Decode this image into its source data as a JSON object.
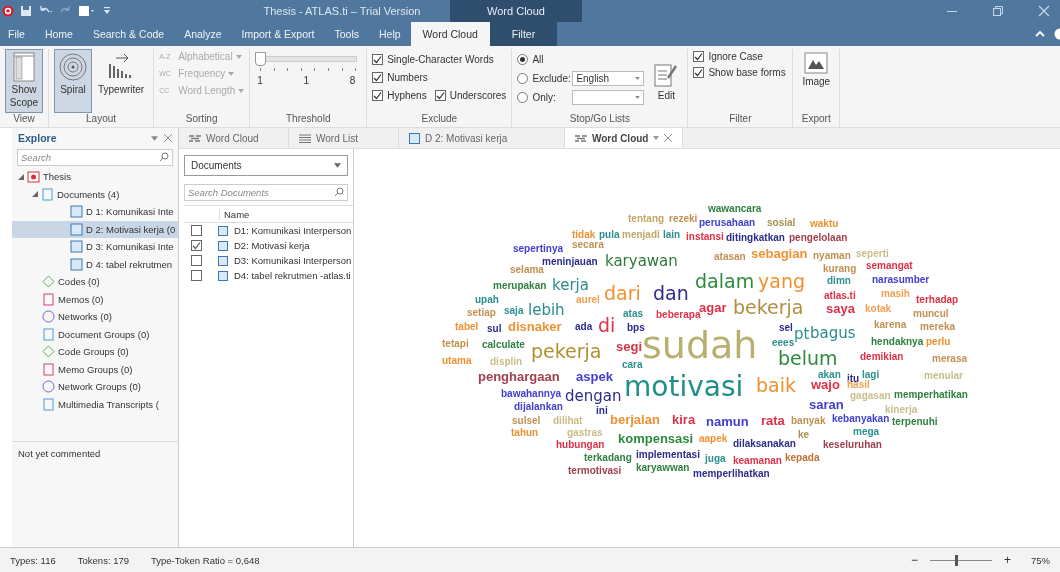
{
  "window": {
    "title": "Thesis - ATLAS.ti – Trial Version",
    "context_title": "Word Cloud"
  },
  "menu_tabs": [
    {
      "label": "File",
      "selected": false
    },
    {
      "label": "Home",
      "selected": false
    },
    {
      "label": "Search & Code",
      "selected": false
    },
    {
      "label": "Analyze",
      "selected": false
    },
    {
      "label": "Import & Export",
      "selected": false
    },
    {
      "label": "Tools",
      "selected": false
    },
    {
      "label": "Help",
      "selected": false
    },
    {
      "label": "Word Cloud",
      "selected": true
    },
    {
      "label": "Filter",
      "selected": false
    }
  ],
  "ribbon": {
    "view": {
      "label": "View",
      "button": {
        "label": "Show Scope",
        "selected": true
      }
    },
    "layout": {
      "label": "Layout",
      "buttons": [
        {
          "label": "Spiral",
          "kind": "spiral",
          "selected": true
        },
        {
          "label": "Typewriter",
          "kind": "typewriter",
          "selected": false
        }
      ]
    },
    "sorting": {
      "label": "Sorting",
      "options": [
        {
          "icon_text": "A-Z",
          "label": "Alphabetical",
          "disabled": true
        },
        {
          "icon_text": "WC",
          "label": "Frequency",
          "disabled": true
        },
        {
          "icon_text": "CC",
          "label": "Word Length",
          "disabled": true
        }
      ]
    },
    "threshold": {
      "label": "Threshold",
      "level": 0,
      "ticks": [
        "1",
        "1",
        "8"
      ]
    },
    "exclude": {
      "label": "Exclude",
      "checkboxes": [
        {
          "label": "Single-Character Words",
          "checked": true
        },
        {
          "label": "Numbers",
          "checked": true
        },
        {
          "label": "Hyphens",
          "checked": true
        },
        {
          "label": "Underscores",
          "checked": true
        }
      ]
    },
    "stop_go": {
      "label": "Stop/Go Lists",
      "radios": [
        {
          "label": "All",
          "selected": true
        },
        {
          "label": "Exclude:",
          "selected": false,
          "value": "English"
        },
        {
          "label": "Only:",
          "selected": false
        }
      ],
      "edit": "Edit"
    },
    "filter": {
      "label": "Filter",
      "checkboxes": [
        {
          "label": "Ignore Case",
          "checked": true
        },
        {
          "label": "Show base forms",
          "checked": true
        }
      ]
    },
    "export": {
      "label": "Export",
      "button": "Image"
    }
  },
  "explore": {
    "title": "Explore",
    "search_placeholder": "Search",
    "tree": [
      {
        "label": "Thesis",
        "kind": "project",
        "expanded": true,
        "selected": false,
        "children": [
          {
            "label": "Documents (4)",
            "kind": "documents",
            "expanded": true,
            "selected": false,
            "children": [
              {
                "label": "D 1: Komunikasi Inte",
                "kind": "doc",
                "selected": false
              },
              {
                "label": "D 2: Motivasi kerja (0",
                "kind": "doc",
                "selected": true
              },
              {
                "label": "D 3: Komunikasi Inte",
                "kind": "doc",
                "selected": false
              },
              {
                "label": "D 4: tabel rekrutmen",
                "kind": "doc",
                "selected": false
              }
            ]
          },
          {
            "label": "Codes (0)",
            "kind": "codes",
            "selected": false
          },
          {
            "label": "Memos (0)",
            "kind": "memos",
            "selected": false
          },
          {
            "label": "Networks (0)",
            "kind": "networks",
            "selected": false
          },
          {
            "label": "Document Groups (0)",
            "kind": "docgroups",
            "selected": false
          },
          {
            "label": "Code Groups (0)",
            "kind": "codegroups",
            "selected": false
          },
          {
            "label": "Memo Groups (0)",
            "kind": "memogroups",
            "selected": false
          },
          {
            "label": "Network Groups (0)",
            "kind": "netgroups",
            "selected": false
          },
          {
            "label": "Multimedia Transcripts (",
            "kind": "transcripts",
            "selected": false
          }
        ]
      }
    ],
    "comment": "Not yet commented"
  },
  "doc_tabs": [
    {
      "label": "Word Cloud",
      "kind": "cloud",
      "selected": false
    },
    {
      "label": "Word List",
      "kind": "list",
      "selected": false
    },
    {
      "label": "D 2: Motivasi kerja",
      "kind": "document",
      "selected": false
    },
    {
      "label": "Word Cloud",
      "kind": "cloud",
      "selected": true
    }
  ],
  "documents": {
    "dropdown": "Documents",
    "search_placeholder": "Search Documents",
    "column": "Name",
    "rows": [
      {
        "name": "D1: Komunikasi Interperson",
        "checked": false
      },
      {
        "name": "D2: Motivasi kerja",
        "checked": true
      },
      {
        "name": "D3: Komunikasi Interperson",
        "checked": false
      },
      {
        "name": "D4: tabel rekrutmen -atlas.ti",
        "checked": false
      }
    ]
  },
  "cloud": {
    "words": [
      {
        "text": "wawancara",
        "kind": "tiny",
        "color": "#2e8040"
      },
      {
        "text": "tentang",
        "kind": "tiny",
        "color": "#c0a868"
      },
      {
        "text": "rezeki",
        "kind": "tiny",
        "color": "#c09050"
      },
      {
        "text": "perusahaan",
        "kind": "tiny",
        "color": "#4040d0"
      },
      {
        "text": "sosial",
        "kind": "tiny",
        "color": "#a89050"
      },
      {
        "text": "waktu",
        "kind": "tiny",
        "color": "#f09030"
      },
      {
        "text": "tidak",
        "kind": "tiny",
        "color": "#f09030"
      },
      {
        "text": "pula",
        "kind": "tiny",
        "color": "#2a9090"
      },
      {
        "text": "menjadi",
        "kind": "tiny",
        "color": "#c0a868"
      },
      {
        "text": "lain",
        "kind": "tiny",
        "color": "#2a9090"
      },
      {
        "text": "instansi",
        "kind": "tiny",
        "color": "#e03048"
      },
      {
        "text": "ditingkatkan",
        "kind": "tiny",
        "color": "#2c2c8c"
      },
      {
        "text": "pengelolaan",
        "kind": "tiny",
        "color": "#a0404a"
      },
      {
        "text": "sepertinya",
        "kind": "tiny",
        "color": "#4040d0"
      },
      {
        "text": "secara",
        "kind": "tiny",
        "color": "#c09050"
      },
      {
        "text": "meninjauan",
        "kind": "tiny",
        "color": "#2c2c8c"
      },
      {
        "text": "karyawan",
        "kind": "medium",
        "color": "#2e7a3e"
      },
      {
        "text": "atasan",
        "kind": "tiny",
        "color": "#c09050"
      },
      {
        "text": "sebagian",
        "kind": "small",
        "color": "#f09030"
      },
      {
        "text": "nyaman",
        "kind": "tiny",
        "color": "#c09050"
      },
      {
        "text": "seperti",
        "kind": "tiny",
        "color": "#c8bc88"
      },
      {
        "text": "selama",
        "kind": "tiny",
        "color": "#c09050"
      },
      {
        "text": "kurang",
        "kind": "tiny",
        "color": "#c09050"
      },
      {
        "text": "semangat",
        "kind": "tiny",
        "color": "#e03048"
      },
      {
        "text": "merupakan",
        "kind": "tiny",
        "color": "#2e8040"
      },
      {
        "text": "kerja",
        "kind": "medium",
        "color": "#2a8a8a"
      },
      {
        "text": "dalam",
        "kind": "large",
        "color": "#2e8b3e"
      },
      {
        "text": "yang",
        "kind": "large",
        "color": "#f09030"
      },
      {
        "text": "dimn",
        "kind": "tiny",
        "color": "#2a9090"
      },
      {
        "text": "narasumber",
        "kind": "tiny",
        "color": "#4040d0"
      },
      {
        "text": "upah",
        "kind": "tiny",
        "color": "#2a9090"
      },
      {
        "text": "aurel",
        "kind": "tiny",
        "color": "#f0a050"
      },
      {
        "text": "dari",
        "kind": "large",
        "color": "#f09030"
      },
      {
        "text": "dan",
        "kind": "large",
        "color": "#2c2c8c"
      },
      {
        "text": "atlas.ti",
        "kind": "tiny",
        "color": "#e03048"
      },
      {
        "text": "masih",
        "kind": "tiny",
        "color": "#f0a050"
      },
      {
        "text": "terhadap",
        "kind": "tiny",
        "color": "#e03048"
      },
      {
        "text": "setiap",
        "kind": "tiny",
        "color": "#c09050"
      },
      {
        "text": "saja",
        "kind": "tiny",
        "color": "#2a9090"
      },
      {
        "text": "lebih",
        "kind": "medium",
        "color": "#2a8a8a"
      },
      {
        "text": "atas",
        "kind": "tiny",
        "color": "#2a9090"
      },
      {
        "text": "beberapa",
        "kind": "tiny",
        "color": "#e03048"
      },
      {
        "text": "agar",
        "kind": "small",
        "color": "#e03048"
      },
      {
        "text": "bekerja",
        "kind": "large",
        "color": "#b09040"
      },
      {
        "text": "saya",
        "kind": "small",
        "color": "#e03048"
      },
      {
        "text": "kotak",
        "kind": "tiny",
        "color": "#f0a050"
      },
      {
        "text": "muncul",
        "kind": "tiny",
        "color": "#c09050"
      },
      {
        "text": "tabel",
        "kind": "tiny",
        "color": "#f09030"
      },
      {
        "text": "sul",
        "kind": "tiny",
        "color": "#2c2c8c"
      },
      {
        "text": "disnaker",
        "kind": "small",
        "color": "#f09030"
      },
      {
        "text": "ada",
        "kind": "tiny",
        "color": "#2c2c8c"
      },
      {
        "text": "di",
        "kind": "large",
        "color": "#e03048"
      },
      {
        "text": "bps",
        "kind": "tiny",
        "color": "#2c2c8c"
      },
      {
        "text": "sel",
        "kind": "tiny",
        "color": "#2c2c8c"
      },
      {
        "text": "karena",
        "kind": "tiny",
        "color": "#c09050"
      },
      {
        "text": "mereka",
        "kind": "tiny",
        "color": "#c09050"
      },
      {
        "text": "pt",
        "kind": "medium",
        "color": "#2a9090"
      },
      {
        "text": "bagus",
        "kind": "medium",
        "color": "#2a8a8a"
      },
      {
        "text": "tetapi",
        "kind": "tiny",
        "color": "#c09050"
      },
      {
        "text": "calculate",
        "kind": "tiny",
        "color": "#2e8040"
      },
      {
        "text": "pekerja",
        "kind": "large",
        "color": "#b09030"
      },
      {
        "text": "segi",
        "kind": "small",
        "color": "#e03048"
      },
      {
        "text": "sudah",
        "kind": "giant",
        "color": "#b8b070"
      },
      {
        "text": "eees",
        "kind": "tiny",
        "color": "#2a9090"
      },
      {
        "text": "hendaknya",
        "kind": "tiny",
        "color": "#2e8040"
      },
      {
        "text": "perlu",
        "kind": "tiny",
        "color": "#f09030"
      },
      {
        "text": "utama",
        "kind": "tiny",
        "color": "#f09030"
      },
      {
        "text": "displin",
        "kind": "tiny",
        "color": "#c8bc88"
      },
      {
        "text": "cara",
        "kind": "tiny",
        "color": "#2a9090"
      },
      {
        "text": "belum",
        "kind": "large",
        "color": "#2e8b3e"
      },
      {
        "text": "demikian",
        "kind": "tiny",
        "color": "#e03048"
      },
      {
        "text": "merasa",
        "kind": "tiny",
        "color": "#c09050"
      },
      {
        "text": "penghargaan",
        "kind": "small",
        "color": "#a0404a"
      },
      {
        "text": "aspek",
        "kind": "small",
        "color": "#4040d0"
      },
      {
        "text": "motivasi",
        "kind": "huge",
        "color": "#1e9088"
      },
      {
        "text": "baik",
        "kind": "large",
        "color": "#f09030"
      },
      {
        "text": "akan",
        "kind": "tiny",
        "color": "#2a9090"
      },
      {
        "text": "wajo",
        "kind": "small",
        "color": "#e03048"
      },
      {
        "text": "itu",
        "kind": "tiny",
        "color": "#2c2c8c"
      },
      {
        "text": "hasil",
        "kind": "tiny",
        "color": "#f0a050"
      },
      {
        "text": "lagi",
        "kind": "tiny",
        "color": "#2a9090"
      },
      {
        "text": "menular",
        "kind": "tiny",
        "color": "#c8bc88"
      },
      {
        "text": "bawahannya",
        "kind": "tiny",
        "color": "#4040d0"
      },
      {
        "text": "dengan",
        "kind": "medium",
        "color": "#2c2c8c"
      },
      {
        "text": "gagasan",
        "kind": "tiny",
        "color": "#c8bc88"
      },
      {
        "text": "memperhatikan",
        "kind": "tiny",
        "color": "#2e8040"
      },
      {
        "text": "dijalankan",
        "kind": "tiny",
        "color": "#4040d0"
      },
      {
        "text": "ini",
        "kind": "tiny",
        "color": "#2c2c8c"
      },
      {
        "text": "saran",
        "kind": "small",
        "color": "#4040d0"
      },
      {
        "text": "kinerja",
        "kind": "tiny",
        "color": "#c8bc88"
      },
      {
        "text": "sulsel",
        "kind": "tiny",
        "color": "#c09050"
      },
      {
        "text": "dilihat",
        "kind": "tiny",
        "color": "#c8bc88"
      },
      {
        "text": "berjalan",
        "kind": "small",
        "color": "#f09030"
      },
      {
        "text": "kira",
        "kind": "small",
        "color": "#e03048"
      },
      {
        "text": "namun",
        "kind": "small",
        "color": "#4040d0"
      },
      {
        "text": "rata",
        "kind": "small",
        "color": "#e03048"
      },
      {
        "text": "banyak",
        "kind": "tiny",
        "color": "#c09050"
      },
      {
        "text": "kebanyakan",
        "kind": "tiny",
        "color": "#4040d0"
      },
      {
        "text": "terpenuhi",
        "kind": "tiny",
        "color": "#2e8040"
      },
      {
        "text": "tahun",
        "kind": "tiny",
        "color": "#f09030"
      },
      {
        "text": "gastras",
        "kind": "tiny",
        "color": "#c8bc88"
      },
      {
        "text": "ke",
        "kind": "tiny",
        "color": "#a89050"
      },
      {
        "text": "mega",
        "kind": "tiny",
        "color": "#2a9090"
      },
      {
        "text": "hubungan",
        "kind": "tiny",
        "color": "#e03048"
      },
      {
        "text": "kompensasi",
        "kind": "small",
        "color": "#2e8b3e"
      },
      {
        "text": "aapek",
        "kind": "tiny",
        "color": "#f09030"
      },
      {
        "text": "dilaksanakan",
        "kind": "tiny",
        "color": "#2c2c8c"
      },
      {
        "text": "keseluruhan",
        "kind": "tiny",
        "color": "#a0404a"
      },
      {
        "text": "terkadang",
        "kind": "tiny",
        "color": "#2e8040"
      },
      {
        "text": "implementasi",
        "kind": "tiny",
        "color": "#2c2c8c"
      },
      {
        "text": "juga",
        "kind": "tiny",
        "color": "#2a9090"
      },
      {
        "text": "keamanan",
        "kind": "tiny",
        "color": "#e03048"
      },
      {
        "text": "kepada",
        "kind": "tiny",
        "color": "#c07030"
      },
      {
        "text": "termotivasi",
        "kind": "tiny",
        "color": "#a0404a"
      },
      {
        "text": "karyawwan",
        "kind": "tiny",
        "color": "#2e8040"
      },
      {
        "text": "memperlihatkan",
        "kind": "tiny",
        "color": "#2c2c8c"
      }
    ]
  },
  "status_bar": {
    "types": "Types: 116",
    "tokens": "Tokens: 179",
    "ratio": "Type-Token Ratio = 0,648",
    "zoom_minus": "−",
    "zoom_plus": "+",
    "zoom_slider": {
      "level": 0.45
    },
    "zoom": "75%"
  }
}
